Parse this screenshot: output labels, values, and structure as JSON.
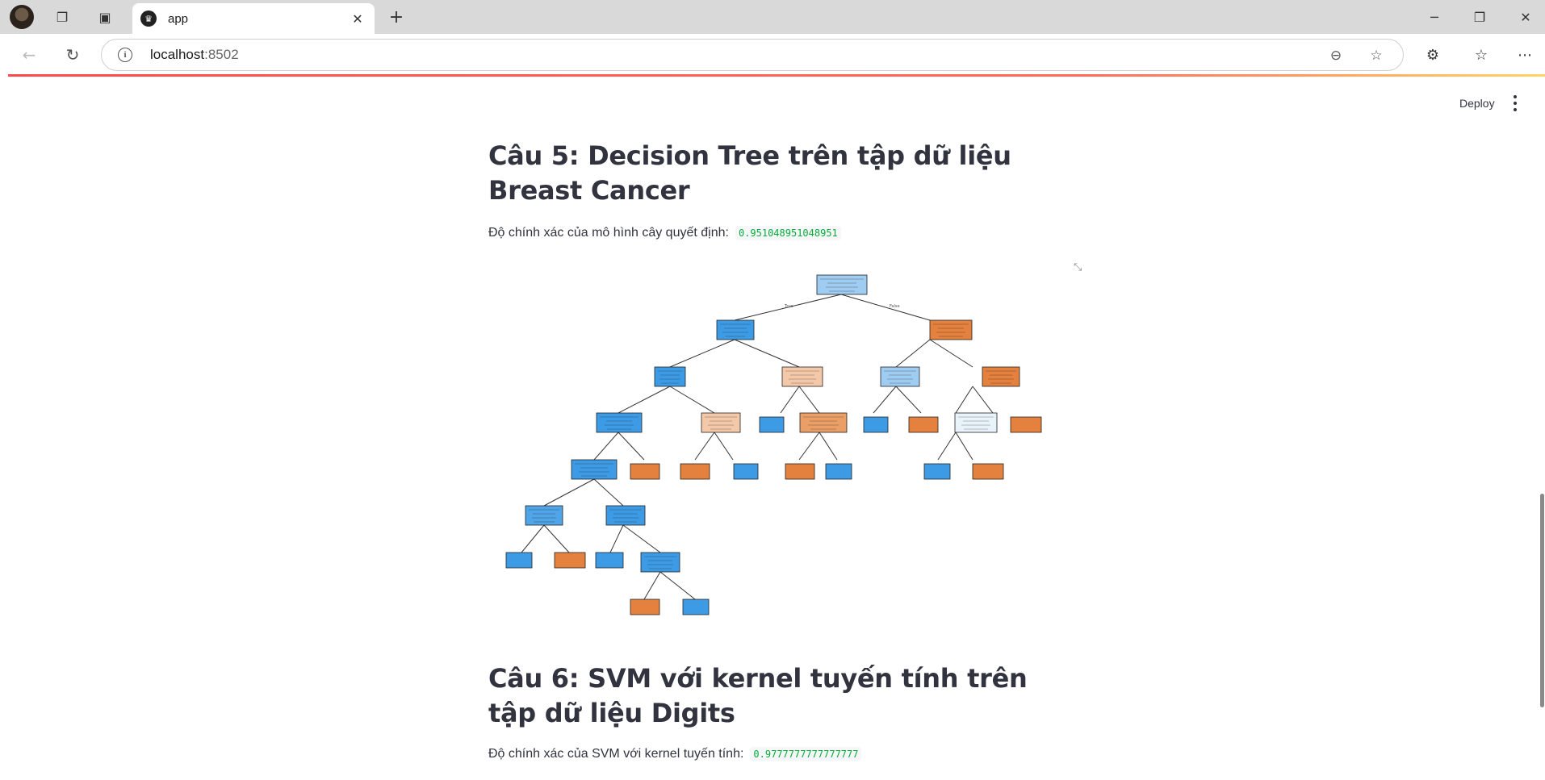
{
  "browser": {
    "tab_title": "app",
    "tab_favicon": "streamlit-icon",
    "url_host": "localhost",
    "url_port": ":8502"
  },
  "header": {
    "deploy_label": "Deploy"
  },
  "section5": {
    "title": "Câu 5: Decision Tree trên tập dữ liệu Breast Cancer",
    "accuracy_label": "Độ chính xác của mô hình cây quyết định:",
    "accuracy_value": "0.951048951048951"
  },
  "section6": {
    "title": "Câu 6: SVM với kernel tuyến tính trên tập dữ liệu Digits",
    "accuracy_label": "Độ chính xác của SVM với kernel tuyến tính:",
    "accuracy_value": "0.9777777777777777"
  },
  "tree": {
    "edge_true": "True",
    "edge_false": "False",
    "colors": {
      "benign_strong": "#3d9be6",
      "benign_light": "#9fcdf2",
      "benign_pale": "#e9f3fc",
      "malignant_strong": "#e5813e",
      "malignant_light": "#f4c9a9",
      "malignant_mid": "#eb9f66"
    }
  }
}
